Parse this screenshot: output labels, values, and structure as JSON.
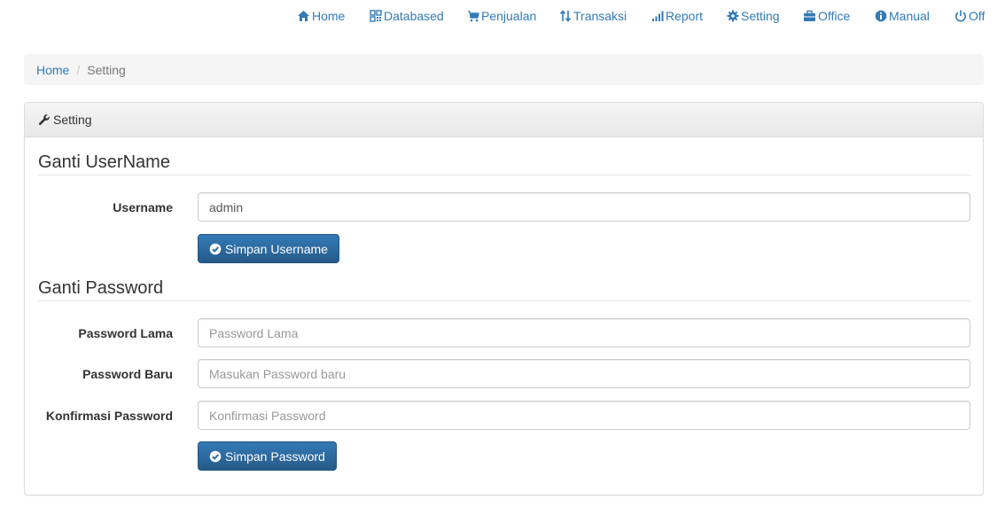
{
  "nav": {
    "items": [
      {
        "label": "Home",
        "icon": "home-icon"
      },
      {
        "label": "Databased",
        "icon": "qrcode-icon"
      },
      {
        "label": "Penjualan",
        "icon": "shopping-cart-icon"
      },
      {
        "label": "Transaksi",
        "icon": "sort-arrows-icon"
      },
      {
        "label": "Report",
        "icon": "signal-bars-icon"
      },
      {
        "label": "Setting",
        "icon": "gear-icon"
      },
      {
        "label": "Office",
        "icon": "briefcase-icon"
      },
      {
        "label": "Manual",
        "icon": "info-circle-icon"
      },
      {
        "label": "Off",
        "icon": "power-off-icon"
      }
    ]
  },
  "breadcrumb": {
    "home": "Home",
    "separator": "/",
    "current": "Setting"
  },
  "panel": {
    "title": "Setting",
    "title_icon": "wrench-icon"
  },
  "username_section": {
    "title": "Ganti UserName",
    "field_label": "Username",
    "field_value": "admin",
    "button_label": "Simpan Username",
    "button_icon": "check-circle-icon"
  },
  "password_section": {
    "title": "Ganti Password",
    "old_label": "Password Lama",
    "old_placeholder": "Password Lama",
    "new_label": "Password Baru",
    "new_placeholder": "Masukan Password baru",
    "confirm_label": "Konfirmasi Password",
    "confirm_placeholder": "Konfirmasi Password",
    "button_label": "Simpan Password",
    "button_icon": "check-circle-icon"
  },
  "colors": {
    "link": "#337ab7",
    "primary_button": "#2e6da4",
    "breadcrumb_bg": "#f5f5f5",
    "panel_border": "#dddddd"
  }
}
